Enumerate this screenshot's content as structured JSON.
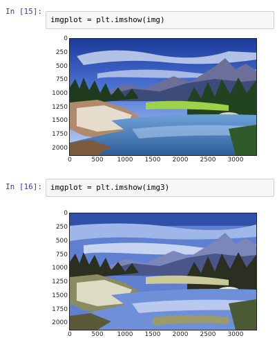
{
  "cells": [
    {
      "prompt": "In [15]:",
      "code": "imgplot = plt.imshow(img)",
      "image": "hdr-alpine-lake-landscape",
      "y_ticks": [
        "0",
        "250",
        "500",
        "750",
        "1000",
        "1250",
        "1500",
        "1750",
        "2000"
      ],
      "x_ticks": [
        "0",
        "500",
        "1000",
        "1500",
        "2000",
        "2500",
        "3000"
      ]
    },
    {
      "prompt": "In [16]:",
      "code": "imgplot = plt.imshow(img3)",
      "image": "posterized-alpine-lake-landscape",
      "y_ticks": [
        "0",
        "250",
        "500",
        "750",
        "1000",
        "1250",
        "1500",
        "1750",
        "2000"
      ],
      "x_ticks": [
        "0",
        "500",
        "1000",
        "1500",
        "2000",
        "2500",
        "3000"
      ]
    }
  ]
}
